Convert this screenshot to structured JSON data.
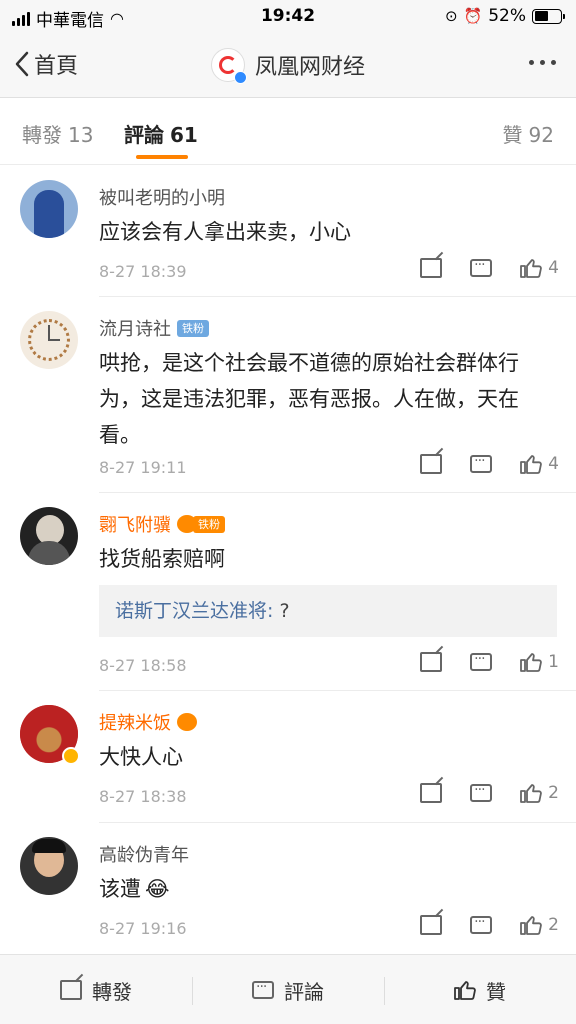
{
  "status_bar": {
    "carrier": "中華電信",
    "time": "19:42",
    "battery": "52%",
    "battery_level": 0.52
  },
  "nav": {
    "back_label": "首頁",
    "title": "凤凰网财经",
    "logo_text": "凤凰网财经"
  },
  "tabs": {
    "repost_label": "轉發",
    "repost_count": "13",
    "comment_label": "評論",
    "comment_count": "61",
    "like_label": "贊",
    "like_count": "92"
  },
  "comments": [
    {
      "user": "被叫老明的小明",
      "text": "应该会有人拿出来卖，小心",
      "time": "8-27 18:39",
      "likes": "4"
    },
    {
      "user": "流月诗社",
      "badge": "铁粉",
      "text": "哄抢，是这个社会最不道德的原始社会群体行为，这是违法犯罪，恶有恶报。人在做，天在看。",
      "time": "8-27 19:11",
      "likes": "4"
    },
    {
      "user": "翾飞附骥",
      "badge": "铁粉",
      "text": "找货船索赔啊",
      "reply_user": "诺斯丁汉兰达准将:",
      "reply_text": " ?",
      "time": "8-27 18:58",
      "likes": "1"
    },
    {
      "user": "提辣米饭",
      "text": "大快人心",
      "time": "8-27 18:38",
      "likes": "2"
    },
    {
      "user": "高龄伪青年",
      "text": "该遭",
      "emoji": "😂",
      "time": "8-27 19:16",
      "likes": "2"
    }
  ],
  "bottom_bar": {
    "repost": "轉發",
    "comment": "評論",
    "like": "贊"
  },
  "colors": {
    "accent": "#ff8200",
    "orange_name": "#ff6a00",
    "reply_name": "#4a6fa0"
  }
}
